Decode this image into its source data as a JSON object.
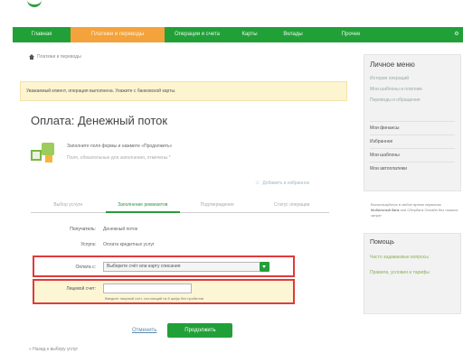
{
  "nav": {
    "items": [
      {
        "label": "Главная",
        "active": false
      },
      {
        "label": "Платежи и переводы",
        "active": true
      },
      {
        "label": "Операции и счета",
        "active": false
      },
      {
        "label": "Карты",
        "active": false
      },
      {
        "label": "Вклады",
        "active": false
      },
      {
        "label": "Прочее",
        "active": false
      },
      {
        "label": "⚙",
        "active": false
      }
    ]
  },
  "breadcrumb": "Платежи и переводы",
  "notice": "Уважаемый клиент, операция выполнена. Укажите с банковской карты.",
  "page_title": "Оплата: Денежный поток",
  "payee": {
    "description": "Заполните поля формы и нажмите «Продолжить»",
    "hint": "Поля, обязательные для заполнения, отмечены *"
  },
  "add_favorite": "Добавить в избранное",
  "steps": [
    "Выбор услуги",
    "Заполнение реквизитов",
    "Подтверждение",
    "Статус операции"
  ],
  "form": {
    "payee_label": "Получатель:",
    "payee_value": "Денежный поток",
    "service_label": "Услуга:",
    "service_value": "Оплата кредитных услуг",
    "card_label": "Оплата с:",
    "card_value": "Выберите счёт или карту списания",
    "code_label": "Лицевой счет:",
    "code_help": "Введите лицевой счет, состоящий из 8 цифр без пробелов"
  },
  "actions": {
    "cancel": "Отменить",
    "continue": "Продолжить"
  },
  "back_link": "« Назад к выбору услуг",
  "side": {
    "title": "Личное меню",
    "links": [
      "История операций",
      "Мои шаблоны и платежи",
      "Переводы и обращения"
    ],
    "items": [
      "Мои финансы",
      "Избранное",
      "Мои шаблоны",
      "Мои автоплатежи"
    ]
  },
  "side_info": {
    "text": "Воспользуйтесь в любое время сервисом",
    "highlight": "Мобильный банк",
    "text2": "или Сбербанк Онлайн без лишних затрат"
  },
  "help": {
    "title": "Помощь",
    "links": [
      "Часто задаваемые вопросы",
      "Правила, условия и тарифы"
    ]
  }
}
